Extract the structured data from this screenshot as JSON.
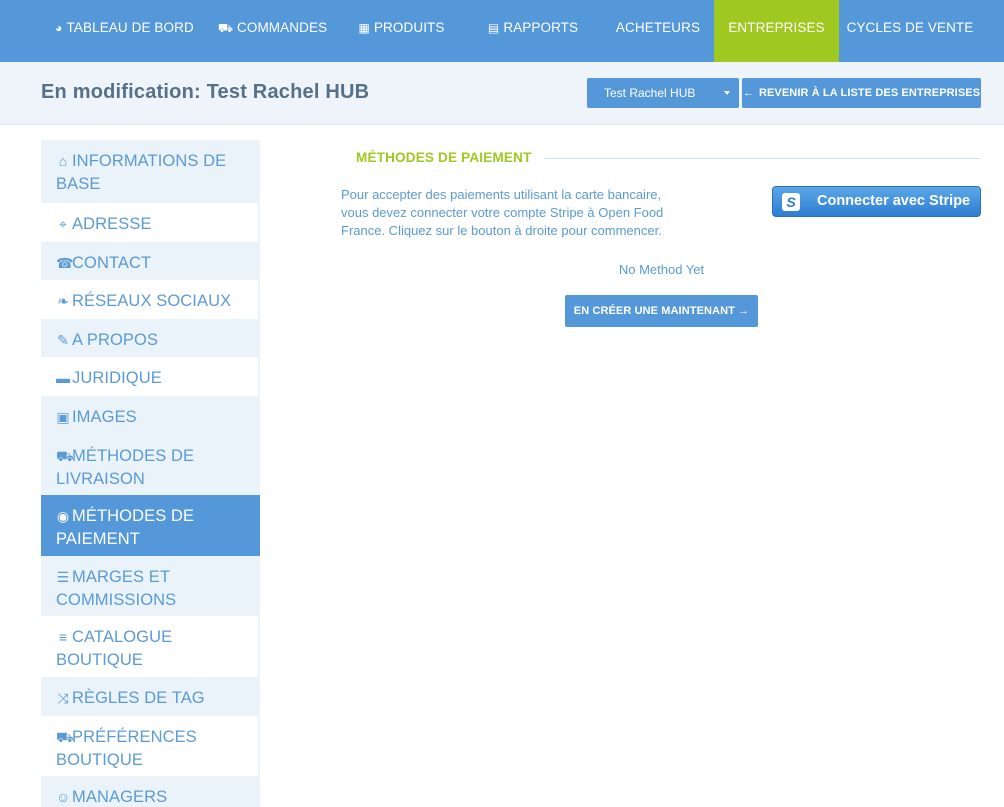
{
  "nav": {
    "items": [
      {
        "label": "Tableau de bord",
        "icon": "dashboard-icon",
        "glyph": "◕"
      },
      {
        "label": "Commandes",
        "icon": "cart-icon",
        "glyph": "⛟"
      },
      {
        "label": "Produits",
        "icon": "grid-icon",
        "glyph": "▦"
      },
      {
        "label": "Rapports",
        "icon": "file-icon",
        "glyph": "▤"
      },
      {
        "label": "Acheteurs"
      },
      {
        "label": "Entreprises"
      },
      {
        "label": "Cycles de vente"
      }
    ],
    "active": "Entreprises",
    "active_color": "#9fc820",
    "bar_color": "#5498da"
  },
  "header": {
    "title": "En modification: Test Rachel HUB",
    "enterprise_select": "Test Rachel HUB",
    "back_button": "REVENIR À LA LISTE DES ENTREPRISES"
  },
  "sidebar": {
    "items": [
      {
        "label": "INFORMATIONS DE BASE",
        "icon": "home-icon",
        "glyph": "⌂"
      },
      {
        "label": "ADRESSE",
        "icon": "map-marker-icon",
        "glyph": "⌖"
      },
      {
        "label": "CONTACT",
        "icon": "phone-icon",
        "glyph": "☎"
      },
      {
        "label": "RÉSEAUX SOCIAUX",
        "icon": "twitter-icon",
        "glyph": "❧"
      },
      {
        "label": "A PROPOS",
        "icon": "pencil-icon",
        "glyph": "✎"
      },
      {
        "label": "JURIDIQUE",
        "icon": "briefcase-icon",
        "glyph": "▬"
      },
      {
        "label": "IMAGES",
        "icon": "image-icon",
        "glyph": "▣"
      },
      {
        "label": "MÉTHODES DE LIVRAISON",
        "icon": "truck-icon",
        "glyph": "⛟"
      },
      {
        "label": "MÉTHODES DE PAIEMENT",
        "icon": "money-icon",
        "glyph": "◉"
      },
      {
        "label": "MARGES ET COMMISSIONS",
        "icon": "list-alt-icon",
        "glyph": "☰"
      },
      {
        "label": "CATALOGUE BOUTIQUE",
        "icon": "list-icon",
        "glyph": "≡"
      },
      {
        "label": "RÈGLES DE TAG",
        "icon": "random-icon",
        "glyph": "⤨"
      },
      {
        "label": "PRÉFÉRENCES BOUTIQUE",
        "icon": "cart-icon",
        "glyph": "⛟"
      },
      {
        "label": "MANAGERS",
        "icon": "user-icon",
        "glyph": "☺"
      }
    ],
    "active": "MÉTHODES DE PAIEMENT"
  },
  "main": {
    "section_title": "MÉTHODES DE PAIEMENT",
    "intro": "Pour accepter des paiements utilisant la carte bancaire, vous devez connecter votre compte Stripe à Open Food France. Cliquez sur le bouton à droite pour commencer.",
    "stripe_button": "Connecter avec Stripe",
    "stripe_logo": "S",
    "no_method": "No Method Yet",
    "create_button": "EN CRÉER UNE MAINTENANT"
  }
}
